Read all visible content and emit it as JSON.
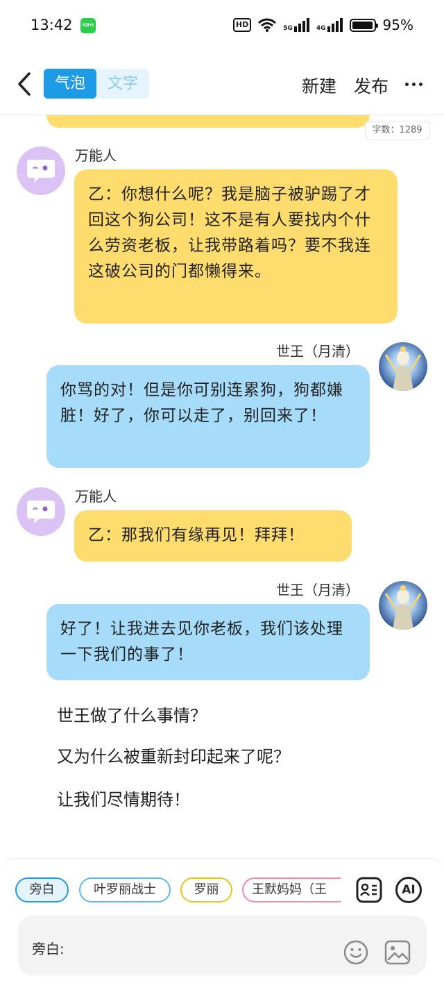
{
  "status_bar": {
    "time": "13:42",
    "app_badge": "iQIYI 爱奇艺",
    "hd_label": "HD",
    "network_5g": "5G",
    "network_4g": "4G",
    "battery_percent": "95%"
  },
  "nav": {
    "back_icon": "chevron-left-icon",
    "tabs": [
      {
        "label": "气泡",
        "active": true
      },
      {
        "label": "文字",
        "active": false
      }
    ],
    "new_label": "新建",
    "publish_label": "发布",
    "more_icon": "more-icon"
  },
  "word_count": "字数：1289",
  "messages": [
    {
      "speaker": "万能人",
      "side": "left",
      "color": "#fedc6e",
      "text": "乙：你想什么呢？我是脑子被驴踢了才回这个狗公司！这不是有人要找内个什么劳资老板，让我带路着吗？要不我连这破公司的门都懒得来。"
    },
    {
      "speaker": "世王（月清）",
      "side": "right",
      "color": "#a6dbfa",
      "text": "你骂的对！但是你可别连累狗，狗都嫌脏！好了，你可以走了，别回来了！"
    },
    {
      "speaker": "万能人",
      "side": "left",
      "color": "#fedc6e",
      "text": "乙：那我们有缘再见！拜拜！"
    },
    {
      "speaker": "世王（月清）",
      "side": "right",
      "color": "#a6dbfa",
      "text": "好了！让我进去见你老板，我们该处理一下我们的事了！"
    }
  ],
  "narration": [
    "世王做了什么事情？",
    "又为什么被重新封印起来了呢？",
    "让我们尽情期待！"
  ],
  "characters": [
    {
      "label": "旁白",
      "selected": true
    },
    {
      "label": "叶罗丽战士",
      "selected": false
    },
    {
      "label": "罗丽",
      "selected": false
    },
    {
      "label": "王默妈妈（王",
      "selected": false
    }
  ],
  "tools": {
    "ai_label": "AI"
  },
  "input": {
    "prefix_label": "旁白:"
  },
  "colors": {
    "accent": "#1d9be6",
    "yellow_bubble": "#fedc6e",
    "blue_bubble": "#a6dbfa"
  }
}
